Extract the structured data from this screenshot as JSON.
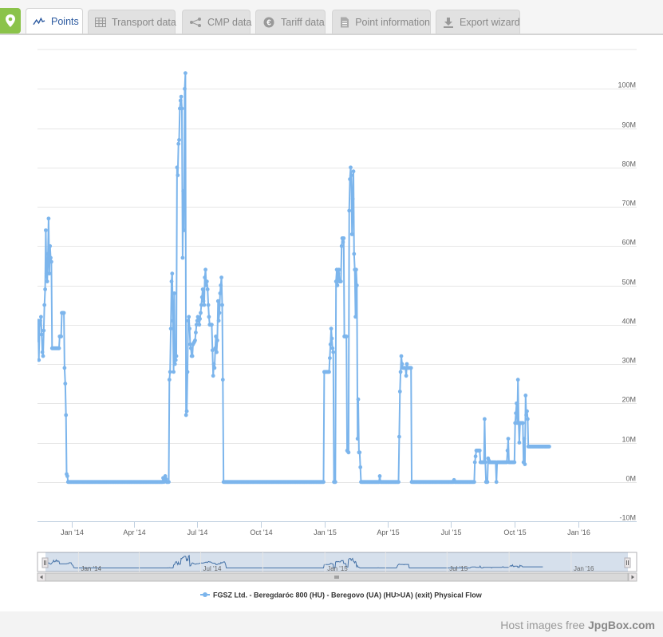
{
  "tabs": [
    {
      "label": "Points",
      "icon": "line-chart-icon",
      "active": true
    },
    {
      "label": "Transport data",
      "icon": "table-icon",
      "active": false
    },
    {
      "label": "CMP data",
      "icon": "share-nodes-icon",
      "active": false
    },
    {
      "label": "Tariff data",
      "icon": "euro-icon",
      "active": false
    },
    {
      "label": "Point information",
      "icon": "document-icon",
      "active": false
    },
    {
      "label": "Export wizard",
      "icon": "download-icon",
      "active": false
    }
  ],
  "chart_data": {
    "type": "line",
    "x_axis_type": "datetime",
    "y_ticks": [
      "-10M",
      "0M",
      "10M",
      "20M",
      "30M",
      "40M",
      "50M",
      "60M",
      "70M",
      "80M",
      "90M",
      "100M"
    ],
    "x_ticks": [
      "Jan '14",
      "Apr '14",
      "Jul '14",
      "Oct '14",
      "Jan '15",
      "Apr '15",
      "Jul '15",
      "Oct '15",
      "Jan '16"
    ],
    "ylim": [
      -10000000,
      110000000
    ],
    "xlim": [
      "2013-11-13",
      "2016-03-25"
    ],
    "grid": true,
    "legend_position": "bottom",
    "series": [
      {
        "name": "FGSZ Ltd. - Beregdaróc 800 (HU) - Beregovo (UA) (HU>UA) (exit) Physical Flow",
        "color": "#7cb5ec",
        "points": [
          [
            "2013-11-13",
            36000000
          ],
          [
            "2013-11-14",
            41000000
          ],
          [
            "2013-11-15",
            31000000
          ],
          [
            "2013-11-16",
            40000000
          ],
          [
            "2013-11-18",
            42000000
          ],
          [
            "2013-11-20",
            33000000
          ],
          [
            "2013-11-21",
            32000000
          ],
          [
            "2013-11-23",
            45000000
          ],
          [
            "2013-11-24",
            49000000
          ],
          [
            "2013-11-25",
            64000000
          ],
          [
            "2013-11-26",
            53000000
          ],
          [
            "2013-11-27",
            51000000
          ],
          [
            "2013-11-28",
            58000000
          ],
          [
            "2013-11-29",
            67000000
          ],
          [
            "2013-11-30",
            53000000
          ],
          [
            "2013-12-01",
            60000000
          ],
          [
            "2013-12-02",
            57000000
          ],
          [
            "2013-12-03",
            56000000
          ],
          [
            "2013-12-04",
            34000000
          ],
          [
            "2013-12-09",
            34000000
          ],
          [
            "2013-12-14",
            34000000
          ],
          [
            "2013-12-15",
            37000000
          ],
          [
            "2013-12-17",
            37000000
          ],
          [
            "2013-12-18",
            43000000
          ],
          [
            "2013-12-21",
            43000000
          ],
          [
            "2013-12-22",
            29000000
          ],
          [
            "2013-12-23",
            25000000
          ],
          [
            "2013-12-24",
            17000000
          ],
          [
            "2013-12-25",
            2000000
          ],
          [
            "2013-12-26",
            1500000
          ],
          [
            "2013-12-27",
            0
          ],
          [
            "2014-02-15",
            0
          ],
          [
            "2014-04-01",
            0
          ],
          [
            "2014-05-12",
            0
          ],
          [
            "2014-05-13",
            1000000
          ],
          [
            "2014-05-14",
            0
          ],
          [
            "2014-05-16",
            1500000
          ],
          [
            "2014-05-18",
            0
          ],
          [
            "2014-05-21",
            0
          ],
          [
            "2014-05-22",
            26000000
          ],
          [
            "2014-05-23",
            28000000
          ],
          [
            "2014-05-24",
            39000000
          ],
          [
            "2014-05-25",
            51000000
          ],
          [
            "2014-05-26",
            53000000
          ],
          [
            "2014-05-27",
            41000000
          ],
          [
            "2014-05-28",
            28000000
          ],
          [
            "2014-05-29",
            48000000
          ],
          [
            "2014-05-30",
            30000000
          ],
          [
            "2014-05-31",
            31000000
          ],
          [
            "2014-06-01",
            32000000
          ],
          [
            "2014-06-02",
            80000000
          ],
          [
            "2014-06-03",
            78000000
          ],
          [
            "2014-06-04",
            86000000
          ],
          [
            "2014-06-05",
            87000000
          ],
          [
            "2014-06-06",
            95000000
          ],
          [
            "2014-06-07",
            97000000
          ],
          [
            "2014-06-08",
            98000000
          ],
          [
            "2014-06-09",
            95000000
          ],
          [
            "2014-06-10",
            57000000
          ],
          [
            "2014-06-11",
            74000000
          ],
          [
            "2014-06-12",
            64000000
          ],
          [
            "2014-06-13",
            100000000
          ],
          [
            "2014-06-14",
            104000000
          ],
          [
            "2014-06-15",
            17000000
          ],
          [
            "2014-06-16",
            18000000
          ],
          [
            "2014-06-17",
            28000000
          ],
          [
            "2014-06-18",
            41000000
          ],
          [
            "2014-06-19",
            42000000
          ],
          [
            "2014-06-20",
            39000000
          ],
          [
            "2014-06-21",
            35000000
          ],
          [
            "2014-06-22",
            34000000
          ],
          [
            "2014-06-23",
            32000000
          ],
          [
            "2014-06-24",
            32000000
          ],
          [
            "2014-06-25",
            35000000
          ],
          [
            "2014-06-28",
            36000000
          ],
          [
            "2014-06-30",
            40000000
          ],
          [
            "2014-07-02",
            42000000
          ],
          [
            "2014-07-04",
            40000000
          ],
          [
            "2014-07-06",
            43000000
          ],
          [
            "2014-07-08",
            47000000
          ],
          [
            "2014-07-09",
            49000000
          ],
          [
            "2014-07-10",
            46000000
          ],
          [
            "2014-07-11",
            45000000
          ],
          [
            "2014-07-12",
            52000000
          ],
          [
            "2014-07-13",
            54000000
          ],
          [
            "2014-07-14",
            50000000
          ],
          [
            "2014-07-15",
            51000000
          ],
          [
            "2014-07-16",
            49000000
          ],
          [
            "2014-07-17",
            45000000
          ],
          [
            "2014-07-18",
            42000000
          ],
          [
            "2014-07-19",
            40000000
          ],
          [
            "2014-07-21",
            40000000
          ],
          [
            "2014-07-22",
            40000000
          ],
          [
            "2014-07-24",
            27000000
          ],
          [
            "2014-07-25",
            30000000
          ],
          [
            "2014-07-26",
            29000000
          ],
          [
            "2014-07-27",
            34000000
          ],
          [
            "2014-07-28",
            37000000
          ],
          [
            "2014-07-29",
            33000000
          ],
          [
            "2014-07-30",
            36000000
          ],
          [
            "2014-07-31",
            46000000
          ],
          [
            "2014-08-01",
            41000000
          ],
          [
            "2014-08-02",
            43000000
          ],
          [
            "2014-08-03",
            48000000
          ],
          [
            "2014-08-04",
            50000000
          ],
          [
            "2014-08-05",
            52000000
          ],
          [
            "2014-08-06",
            45000000
          ],
          [
            "2014-08-07",
            26000000
          ],
          [
            "2014-08-08",
            0
          ],
          [
            "2014-09-15",
            0
          ],
          [
            "2014-10-15",
            0
          ],
          [
            "2014-12-30",
            0
          ],
          [
            "2014-12-31",
            28000000
          ],
          [
            "2015-01-04",
            28000000
          ],
          [
            "2015-01-07",
            28000000
          ],
          [
            "2015-01-09",
            35000000
          ],
          [
            "2015-01-10",
            39000000
          ],
          [
            "2015-01-12",
            34000000
          ],
          [
            "2015-01-13",
            33000000
          ],
          [
            "2015-01-14",
            0
          ],
          [
            "2015-01-16",
            0
          ],
          [
            "2015-01-17",
            51000000
          ],
          [
            "2015-01-18",
            54000000
          ],
          [
            "2015-01-19",
            50000000
          ],
          [
            "2015-01-20",
            53000000
          ],
          [
            "2015-01-21",
            54000000
          ],
          [
            "2015-01-22",
            51000000
          ],
          [
            "2015-01-24",
            51000000
          ],
          [
            "2015-01-25",
            60000000
          ],
          [
            "2015-01-26",
            62000000
          ],
          [
            "2015-01-27",
            61000000
          ],
          [
            "2015-01-28",
            62000000
          ],
          [
            "2015-01-29",
            37000000
          ],
          [
            "2015-02-01",
            37000000
          ],
          [
            "2015-02-02",
            8000000
          ],
          [
            "2015-02-04",
            7500000
          ],
          [
            "2015-02-05",
            69000000
          ],
          [
            "2015-02-06",
            77000000
          ],
          [
            "2015-02-07",
            80000000
          ],
          [
            "2015-02-08",
            78000000
          ],
          [
            "2015-02-09",
            63000000
          ],
          [
            "2015-02-10",
            72000000
          ],
          [
            "2015-02-11",
            79000000
          ],
          [
            "2015-02-12",
            58000000
          ],
          [
            "2015-02-13",
            54000000
          ],
          [
            "2015-02-14",
            42000000
          ],
          [
            "2015-02-15",
            54000000
          ],
          [
            "2015-02-16",
            50000000
          ],
          [
            "2015-02-17",
            11000000
          ],
          [
            "2015-02-18",
            21000000
          ],
          [
            "2015-02-19",
            7500000
          ],
          [
            "2015-02-20",
            7500000
          ],
          [
            "2015-02-22",
            0
          ],
          [
            "2015-03-20",
            0
          ],
          [
            "2015-03-21",
            1500000
          ],
          [
            "2015-03-22",
            0
          ],
          [
            "2015-04-17",
            0
          ],
          [
            "2015-04-19",
            23000000
          ],
          [
            "2015-04-20",
            28000000
          ],
          [
            "2015-04-21",
            32000000
          ],
          [
            "2015-04-22",
            30000000
          ],
          [
            "2015-04-23",
            29000000
          ],
          [
            "2015-04-25",
            29000000
          ],
          [
            "2015-04-27",
            29000000
          ],
          [
            "2015-04-28",
            27000000
          ],
          [
            "2015-04-29",
            30000000
          ],
          [
            "2015-04-30",
            29000000
          ],
          [
            "2015-05-02",
            29000000
          ],
          [
            "2015-05-05",
            29000000
          ],
          [
            "2015-05-06",
            0
          ],
          [
            "2015-06-15",
            0
          ],
          [
            "2015-07-05",
            0
          ],
          [
            "2015-07-06",
            500000
          ],
          [
            "2015-07-07",
            0
          ],
          [
            "2015-08-04",
            0
          ],
          [
            "2015-08-05",
            5000000
          ],
          [
            "2015-08-07",
            8000000
          ],
          [
            "2015-08-10",
            8000000
          ],
          [
            "2015-08-12",
            8000000
          ],
          [
            "2015-08-13",
            5000000
          ],
          [
            "2015-08-18",
            5000000
          ],
          [
            "2015-08-19",
            16000000
          ],
          [
            "2015-08-20",
            5000000
          ],
          [
            "2015-08-21",
            0
          ],
          [
            "2015-08-23",
            0
          ],
          [
            "2015-08-24",
            6000000
          ],
          [
            "2015-08-26",
            5000000
          ],
          [
            "2015-09-02",
            5000000
          ],
          [
            "2015-09-04",
            5000000
          ],
          [
            "2015-09-05",
            0
          ],
          [
            "2015-09-06",
            5000000
          ],
          [
            "2015-09-12",
            5000000
          ],
          [
            "2015-09-20",
            5000000
          ],
          [
            "2015-09-22",
            11000000
          ],
          [
            "2015-09-23",
            5000000
          ],
          [
            "2015-09-28",
            5000000
          ],
          [
            "2015-10-01",
            5000000
          ],
          [
            "2015-10-02",
            15000000
          ],
          [
            "2015-10-04",
            20000000
          ],
          [
            "2015-10-05",
            15000000
          ],
          [
            "2015-10-06",
            26000000
          ],
          [
            "2015-10-07",
            15000000
          ],
          [
            "2015-10-08",
            10000000
          ],
          [
            "2015-10-09",
            15000000
          ],
          [
            "2015-10-13",
            15000000
          ],
          [
            "2015-10-14",
            5000000
          ],
          [
            "2015-10-15",
            11000000
          ],
          [
            "2015-10-16",
            4500000
          ],
          [
            "2015-10-17",
            22000000
          ],
          [
            "2015-10-18",
            17000000
          ],
          [
            "2015-10-19",
            18000000
          ],
          [
            "2015-10-20",
            16000000
          ],
          [
            "2015-10-21",
            9000000
          ],
          [
            "2015-11-01",
            9000000
          ],
          [
            "2015-11-20",
            9000000
          ]
        ]
      }
    ]
  }
}
